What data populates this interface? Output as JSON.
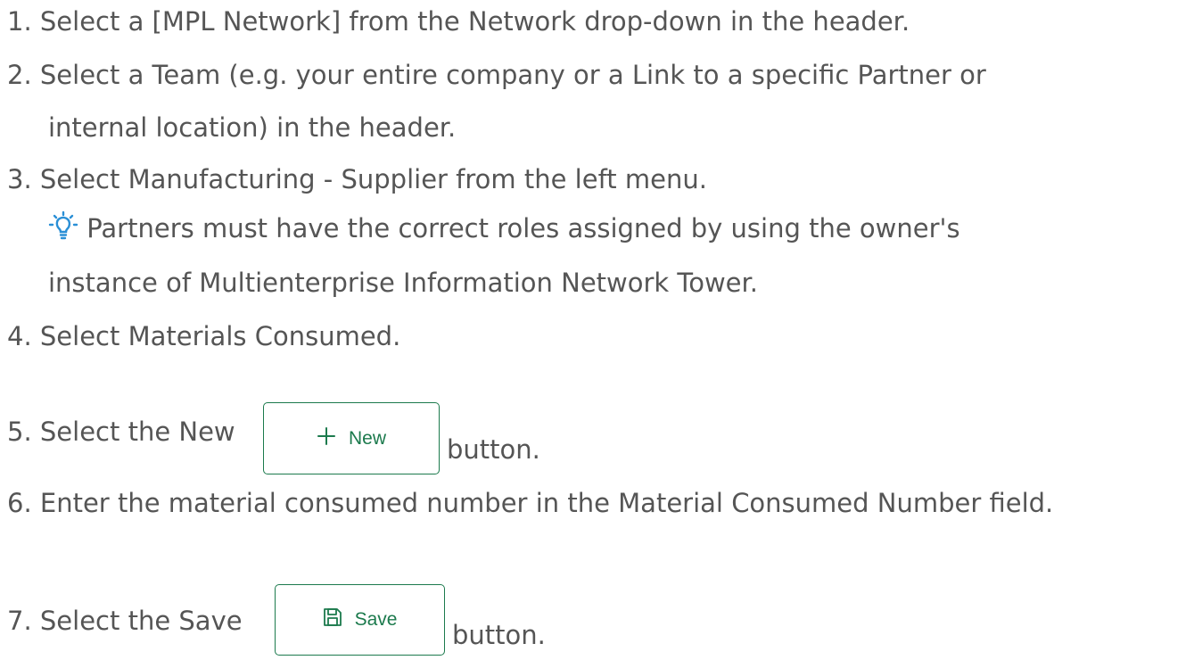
{
  "steps": [
    {
      "number": "1.",
      "text": "Select a [MPL Network] from the Network drop-down in the header."
    },
    {
      "number": "2.",
      "text": "Select a Team (e.g. your entire company or a Link to a specific Partner or",
      "continuation": "internal location) in the header."
    },
    {
      "number": "3.",
      "text": " Select Manufacturing - Supplier from the left menu."
    },
    {
      "number": "4.",
      "text": "Select Materials Consumed."
    },
    {
      "number": "5.",
      "text_before": "Select the New",
      "text_after": "button."
    },
    {
      "number": "6.",
      "text": "Enter the material consumed number in the Material Consumed Number field."
    },
    {
      "number": "7.",
      "text_before": "Select the Save",
      "text_after": "button."
    }
  ],
  "tip": {
    "icon": "lightbulb-icon",
    "line1": "Partners must have the correct roles assigned by using the owner's",
    "line2": "instance of Multienterprise Information Network Tower."
  },
  "buttons": {
    "new": {
      "label": "New",
      "icon": "plus-icon"
    },
    "save": {
      "label": "Save",
      "icon": "floppy-disk-icon"
    }
  },
  "colors": {
    "text": "#555555",
    "accent_green": "#1c7a4d",
    "tip_icon": "#2a8fd6"
  }
}
